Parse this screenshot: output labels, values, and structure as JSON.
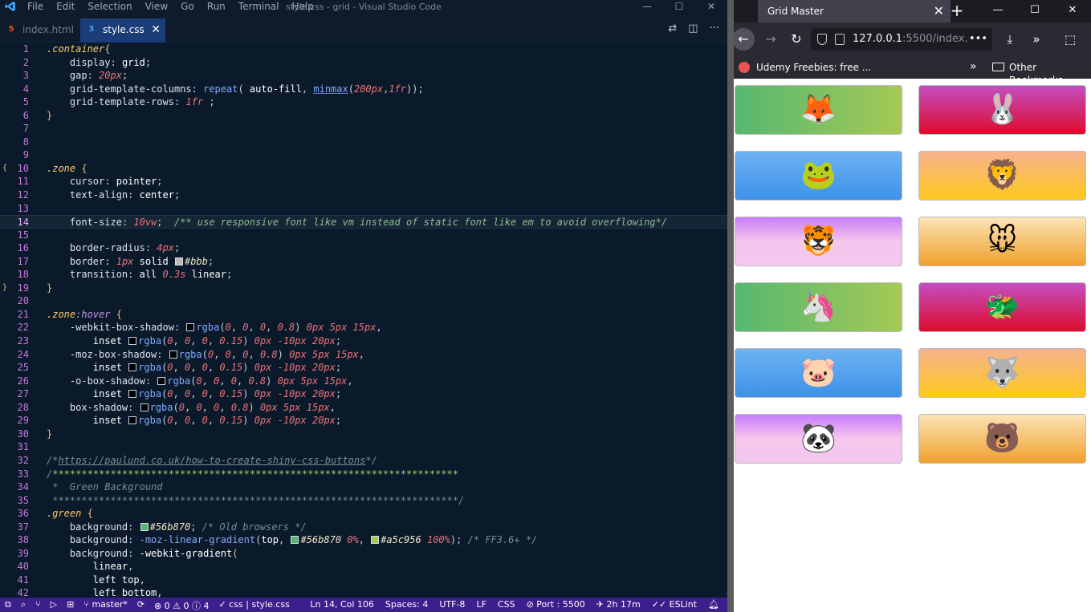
{
  "vscode": {
    "menu": [
      "File",
      "Edit",
      "Selection",
      "View",
      "Go",
      "Run",
      "Terminal",
      "Help"
    ],
    "window_title": "style.css - grid - Visual Studio Code",
    "tabs": [
      {
        "label": "index.html",
        "icon": "html-file-icon"
      },
      {
        "label": "style.css",
        "icon": "css-file-icon",
        "active": true
      }
    ],
    "code_lines": [
      {
        "n": "1",
        "html": "<span class='t-sel'>.container</span><span class='t-br'>{</span>"
      },
      {
        "n": "2",
        "html": "    <span class='t-prop'>display</span><span class='t-pun'>: </span><span class='t-kw'>grid</span><span class='t-pun'>;</span>"
      },
      {
        "n": "3",
        "html": "    <span class='t-prop'>gap</span><span class='t-pun'>: </span><span class='t-num'>20px</span><span class='t-pun'>;</span>"
      },
      {
        "n": "4",
        "html": "    <span class='t-prop'>grid-template-columns</span><span class='t-pun'>: </span><span class='t-fn'>repeat</span><span class='t-pun'>( </span><span class='t-kw'>auto-fill</span><span class='t-pun'>, </span><span class='t-fnu'>minmax</span><span class='t-pun'>(</span><span class='t-num'>200px</span><span class='t-pun'>,</span><span class='t-num'>1fr</span><span class='t-pun'>));</span>"
      },
      {
        "n": "5",
        "html": "    <span class='t-prop'>grid-template-rows</span><span class='t-pun'>: </span><span class='t-num'>1fr</span><span class='t-pun'> ;</span>"
      },
      {
        "n": "6",
        "html": "<span class='t-br'>}</span>"
      },
      {
        "n": "7",
        "html": ""
      },
      {
        "n": "8",
        "html": ""
      },
      {
        "n": "9",
        "html": ""
      },
      {
        "n": "10",
        "html": "<span class='t-sel'>.zone</span> <span class='t-br'>{</span>",
        "gutter": "{"
      },
      {
        "n": "11",
        "html": "    <span class='t-prop'>cursor</span><span class='t-pun'>: </span><span class='t-kw'>pointer</span><span class='t-pun'>;</span>"
      },
      {
        "n": "12",
        "html": "    <span class='t-prop'>text-align</span><span class='t-pun'>: </span><span class='t-kw'>center</span><span class='t-pun'>;</span>"
      },
      {
        "n": "13",
        "html": ""
      },
      {
        "n": "14",
        "html": "    <span class='t-prop'>font-size</span><span class='t-pun'>: </span><span class='t-num'>10vw</span><span class='t-pun'>;  </span><span class='t-comg'>/** use responsive font like vm instead of static font like em to avoid overflowing*/</span>",
        "current": true
      },
      {
        "n": "15",
        "html": ""
      },
      {
        "n": "16",
        "html": "    <span class='t-prop'>border-radius</span><span class='t-pun'>: </span><span class='t-num'>4px</span><span class='t-pun'>;</span>"
      },
      {
        "n": "17",
        "html": "    <span class='t-prop'>border</span><span class='t-pun'>: </span><span class='t-num'>1px</span><span class='t-kw'> solid </span><span class='sw sw-gray'></span><span class='t-hex'>#bbb</span><span class='t-pun'>;</span>"
      },
      {
        "n": "18",
        "html": "    <span class='t-prop'>transition</span><span class='t-pun'>: </span><span class='t-kw'>all </span><span class='t-num'>0.3s</span><span class='t-kw'> linear</span><span class='t-pun'>;</span>"
      },
      {
        "n": "19",
        "html": "<span class='t-br'>}</span>",
        "gutter": "}"
      },
      {
        "n": "20",
        "html": ""
      },
      {
        "n": "21",
        "html": "<span class='t-sel'>.zone</span><span class='t-pseudo'>:hover</span> <span class='t-br'>{</span>"
      },
      {
        "n": "22",
        "html": "    <span class='t-prop'>-webkit-box-shadow</span><span class='t-pun'>: </span><span class='sw sw-dark'></span><span class='t-fn'>rgba</span><span class='t-pun'>(</span><span class='t-num'>0</span><span class='t-pun'>, </span><span class='t-num'>0</span><span class='t-pun'>, </span><span class='t-num'>0</span><span class='t-pun'>, </span><span class='t-num'>0.8</span><span class='t-pun'>) </span><span class='t-num'>0px 5px 15px</span><span class='t-pun'>,</span>"
      },
      {
        "n": "23",
        "html": "        <span class='t-kw'>inset </span><span class='sw sw-dark'></span><span class='t-fn'>rgba</span><span class='t-pun'>(</span><span class='t-num'>0</span><span class='t-pun'>, </span><span class='t-num'>0</span><span class='t-pun'>, </span><span class='t-num'>0</span><span class='t-pun'>, </span><span class='t-num'>0.15</span><span class='t-pun'>) </span><span class='t-num'>0px -10px 20px</span><span class='t-pun'>;</span>"
      },
      {
        "n": "24",
        "html": "    <span class='t-prop'>-moz-box-shadow</span><span class='t-pun'>: </span><span class='sw sw-dark'></span><span class='t-fn'>rgba</span><span class='t-pun'>(</span><span class='t-num'>0</span><span class='t-pun'>, </span><span class='t-num'>0</span><span class='t-pun'>, </span><span class='t-num'>0</span><span class='t-pun'>, </span><span class='t-num'>0.8</span><span class='t-pun'>) </span><span class='t-num'>0px 5px 15px</span><span class='t-pun'>,</span>"
      },
      {
        "n": "25",
        "html": "        <span class='t-kw'>inset </span><span class='sw sw-dark'></span><span class='t-fn'>rgba</span><span class='t-pun'>(</span><span class='t-num'>0</span><span class='t-pun'>, </span><span class='t-num'>0</span><span class='t-pun'>, </span><span class='t-num'>0</span><span class='t-pun'>, </span><span class='t-num'>0.15</span><span class='t-pun'>) </span><span class='t-num'>0px -10px 20px</span><span class='t-pun'>;</span>"
      },
      {
        "n": "26",
        "html": "    <span class='t-prop'>-o-box-shadow</span><span class='t-pun'>: </span><span class='sw sw-dark'></span><span class='t-fn'>rgba</span><span class='t-pun'>(</span><span class='t-num'>0</span><span class='t-pun'>, </span><span class='t-num'>0</span><span class='t-pun'>, </span><span class='t-num'>0</span><span class='t-pun'>, </span><span class='t-num'>0.8</span><span class='t-pun'>) </span><span class='t-num'>0px 5px 15px</span><span class='t-pun'>,</span>"
      },
      {
        "n": "27",
        "html": "        <span class='t-kw'>inset </span><span class='sw sw-dark'></span><span class='t-fn'>rgba</span><span class='t-pun'>(</span><span class='t-num'>0</span><span class='t-pun'>, </span><span class='t-num'>0</span><span class='t-pun'>, </span><span class='t-num'>0</span><span class='t-pun'>, </span><span class='t-num'>0.15</span><span class='t-pun'>) </span><span class='t-num'>0px -10px 20px</span><span class='t-pun'>;</span>"
      },
      {
        "n": "28",
        "html": "    <span class='t-prop'>box-shadow</span><span class='t-pun'>: </span><span class='sw sw-dark'></span><span class='t-fn'>rgba</span><span class='t-pun'>(</span><span class='t-num'>0</span><span class='t-pun'>, </span><span class='t-num'>0</span><span class='t-pun'>, </span><span class='t-num'>0</span><span class='t-pun'>, </span><span class='t-num'>0.8</span><span class='t-pun'>) </span><span class='t-num'>0px 5px 15px</span><span class='t-pun'>,</span>"
      },
      {
        "n": "29",
        "html": "        <span class='t-kw'>inset </span><span class='sw sw-dark'></span><span class='t-fn'>rgba</span><span class='t-pun'>(</span><span class='t-num'>0</span><span class='t-pun'>, </span><span class='t-num'>0</span><span class='t-pun'>, </span><span class='t-num'>0</span><span class='t-pun'>, </span><span class='t-num'>0.15</span><span class='t-pun'>) </span><span class='t-num'>0px -10px 20px</span><span class='t-pun'>;</span>"
      },
      {
        "n": "30",
        "html": "<span class='t-br'>}</span>"
      },
      {
        "n": "31",
        "html": ""
      },
      {
        "n": "32",
        "html": "<span class='t-com'>/*<u>https://paulund.co.uk/how-to-create-shiny-css-buttons</u>*/</span>"
      },
      {
        "n": "33",
        "html": "<span class='t-com'>/</span><span class='t-ast'>**********************************************************************</span>"
      },
      {
        "n": "34",
        "html": "<span class='t-com'> *  Green Background</span>"
      },
      {
        "n": "35",
        "html": "<span class='t-com'> **********************************************************************/</span>"
      },
      {
        "n": "36",
        "html": "<span class='t-sel'>.green</span> <span class='t-br'>{</span>"
      },
      {
        "n": "37",
        "html": "    <span class='t-prop'>background</span><span class='t-pun'>: </span><span class='sw sw-green'></span><span class='t-hex'>#56b870</span><span class='t-pun'>; </span><span class='t-com'>/* Old browsers */</span>"
      },
      {
        "n": "38",
        "html": "    <span class='t-prop'>background</span><span class='t-pun'>: </span><span class='t-fn'>-moz-linear-gradient</span><span class='t-pun'>(</span><span class='t-kw'>top</span><span class='t-pun'>, </span><span class='sw sw-green'></span><span class='t-hex'>#56b870 </span><span class='t-num'>0%</span><span class='t-pun'>, </span><span class='sw sw-lgreen'></span><span class='t-hex'>#a5c956 </span><span class='t-num'>100%</span><span class='t-pun'>); </span><span class='t-com'>/* FF3.6+ */</span>"
      },
      {
        "n": "39",
        "html": "    <span class='t-prop'>background</span><span class='t-pun'>: </span><span class='t-kw'>-webkit-gradient</span><span class='t-br'>(</span>"
      },
      {
        "n": "40",
        "html": "        <span class='t-kw'>linear</span><span class='t-pun'>,</span>"
      },
      {
        "n": "41",
        "html": "        <span class='t-kw'>left top</span><span class='t-pun'>,</span>"
      },
      {
        "n": "42",
        "html": "        <span class='t-kw'>left bottom</span><span class='t-pun'>,</span>"
      }
    ],
    "status": {
      "branch": "master*",
      "errors": "0",
      "warnings": "0",
      "info": "4",
      "lang_css": "css | style.css",
      "position": "Ln 14, Col 106",
      "spaces": "Spaces: 4",
      "encoding": "UTF-8",
      "eol": "LF",
      "language": "CSS",
      "port": "Port : 5500",
      "time": "2h 17m",
      "eslint": "ESLint"
    }
  },
  "browser": {
    "tab_title": "Grid Master",
    "url_main": "127.0.0.1",
    "url_dim": ":5500/index.",
    "bookmarks": {
      "udemy": "Udemy Freebies: free ...",
      "other": "Other Bookmarks"
    },
    "zones": [
      {
        "emoji": "🦊",
        "cls": "green",
        "icon": "fox-icon"
      },
      {
        "emoji": "🐰",
        "cls": "red",
        "icon": "rabbit-icon"
      },
      {
        "emoji": "🐸",
        "cls": "blue",
        "icon": "frog-icon"
      },
      {
        "emoji": "🦁",
        "cls": "yellow",
        "icon": "lion-icon"
      },
      {
        "emoji": "🐯",
        "cls": "purple",
        "icon": "tiger-icon"
      },
      {
        "emoji": "🐭",
        "cls": "orange",
        "icon": "mouse-icon"
      },
      {
        "emoji": "🦄",
        "cls": "green",
        "icon": "unicorn-icon"
      },
      {
        "emoji": "🐲",
        "cls": "red",
        "icon": "dragon-icon"
      },
      {
        "emoji": "🐷",
        "cls": "blue",
        "icon": "pig-icon"
      },
      {
        "emoji": "🐺",
        "cls": "yellow",
        "icon": "wolf-icon"
      },
      {
        "emoji": "🐼",
        "cls": "purple",
        "icon": "panda-icon"
      },
      {
        "emoji": "🐻",
        "cls": "orange",
        "icon": "bear-icon"
      }
    ]
  }
}
